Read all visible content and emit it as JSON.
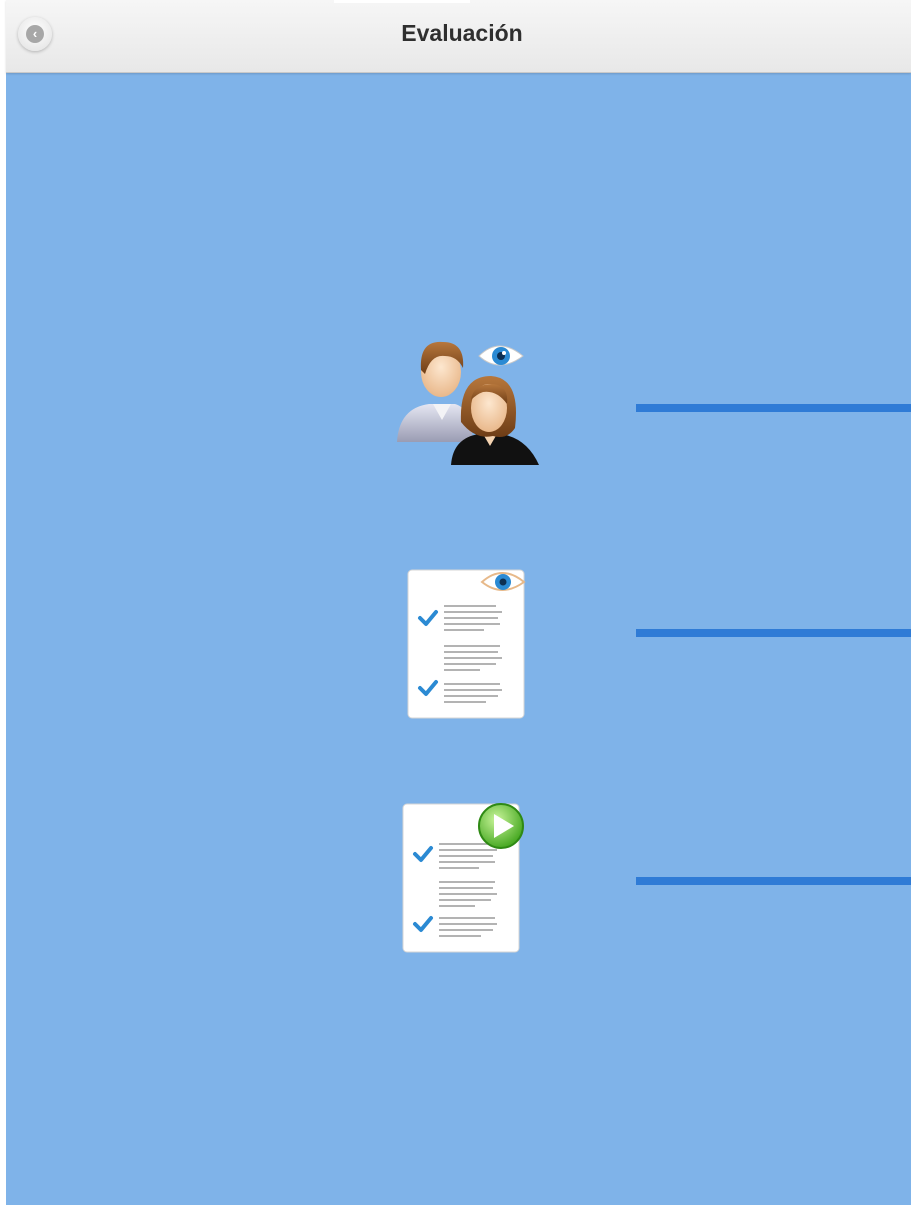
{
  "header": {
    "title": "Evaluación",
    "back_icon": "chevron-left-icon",
    "back_glyph": "‹"
  },
  "items": [
    {
      "icon": "users-eye-icon"
    },
    {
      "icon": "document-eye-icon"
    },
    {
      "icon": "document-play-icon"
    }
  ],
  "colors": {
    "background": "#7fb3e9",
    "header": "#eeeeee",
    "accent_line": "#2f7bd6"
  }
}
